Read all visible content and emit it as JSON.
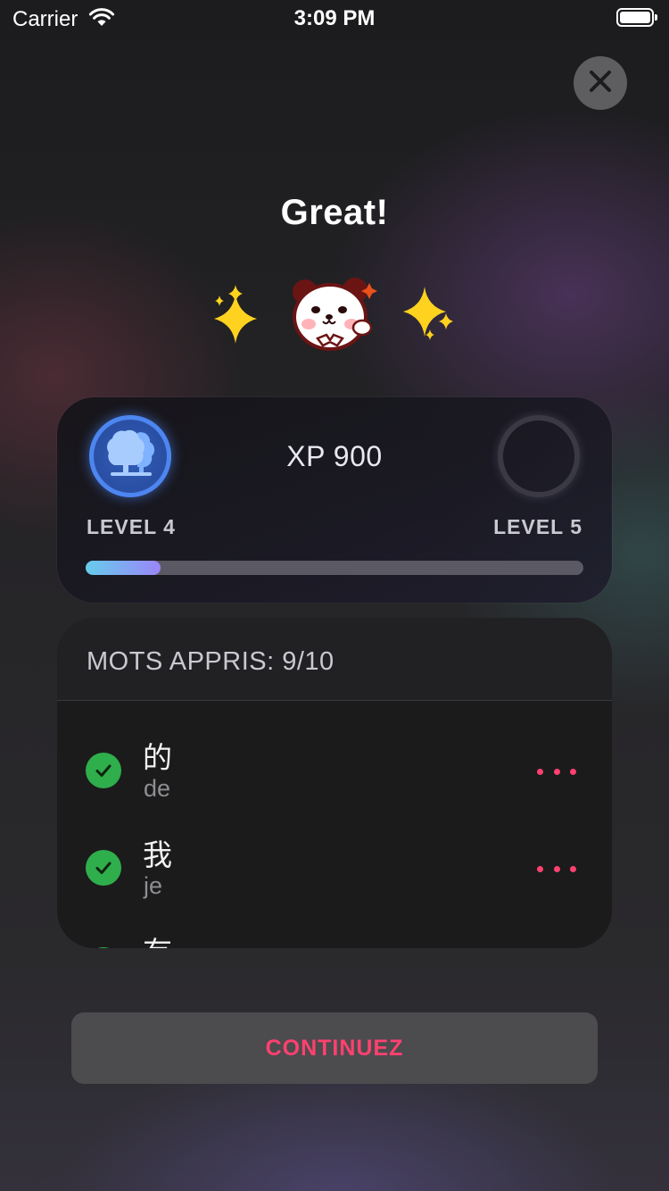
{
  "status_bar": {
    "carrier": "Carrier",
    "time": "3:09 PM"
  },
  "header": {
    "title": "Great!"
  },
  "icons": {
    "close": "close-icon",
    "sparkles": "sparkles-icon",
    "mascot": "panda-mascot-icon",
    "level_badge": "tree-icon",
    "check": "checkmark-icon",
    "more": "more-dots-icon"
  },
  "xp_card": {
    "xp_text": "XP 900",
    "current_level": "LEVEL 4",
    "next_level": "LEVEL 5",
    "progress": 0.15
  },
  "words": {
    "title": "MOTS APPRIS: 9/10",
    "items": [
      {
        "hanzi": "的",
        "pinyin": "de",
        "learned": true
      },
      {
        "hanzi": "我",
        "pinyin": "je",
        "learned": true
      },
      {
        "hanzi": "有",
        "pinyin": "",
        "learned": true
      }
    ]
  },
  "footer": {
    "continue_label": "CONTINUEZ"
  },
  "colors": {
    "accent": "#ff416f",
    "success": "#2fae4c",
    "level_blue": "#3b6fd6",
    "progress_start": "#66ccec",
    "progress_end": "#9b86f8"
  }
}
